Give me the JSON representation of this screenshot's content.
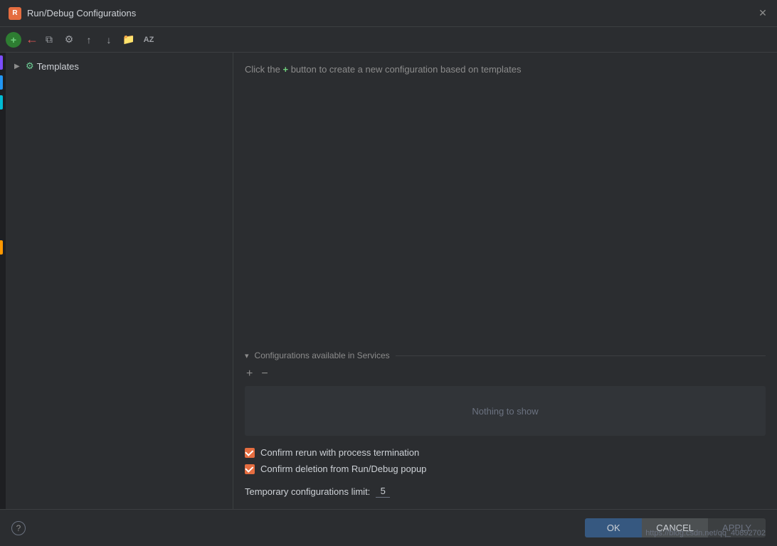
{
  "dialog": {
    "title": "Run/Debug Configurations",
    "app_icon_letter": "R"
  },
  "toolbar": {
    "add_label": "+",
    "copy_label": "⧉",
    "settings_label": "⚙",
    "up_label": "↑",
    "down_label": "↓",
    "folder_label": "⬜",
    "sort_label": "AZ"
  },
  "tree": {
    "templates_label": "Templates",
    "templates_arrow": "▶"
  },
  "right_panel": {
    "info_text_before": "Click the",
    "info_plus": "+",
    "info_text_after": "button to create a new configuration based on templates"
  },
  "services_section": {
    "chevron": "▾",
    "title": "Configurations available in Services",
    "add_btn": "+",
    "remove_btn": "−",
    "empty_label": "Nothing to show"
  },
  "checkboxes": [
    {
      "label": "Confirm rerun with process termination",
      "checked": true
    },
    {
      "label": "Confirm deletion from Run/Debug popup",
      "checked": true
    }
  ],
  "temp_config": {
    "label": "Temporary configurations limit:",
    "value": "5"
  },
  "buttons": {
    "ok": "OK",
    "cancel": "CANCEL",
    "apply": "APPLY"
  },
  "url_hint": "https://blog.csdn.net/qq_40892702"
}
